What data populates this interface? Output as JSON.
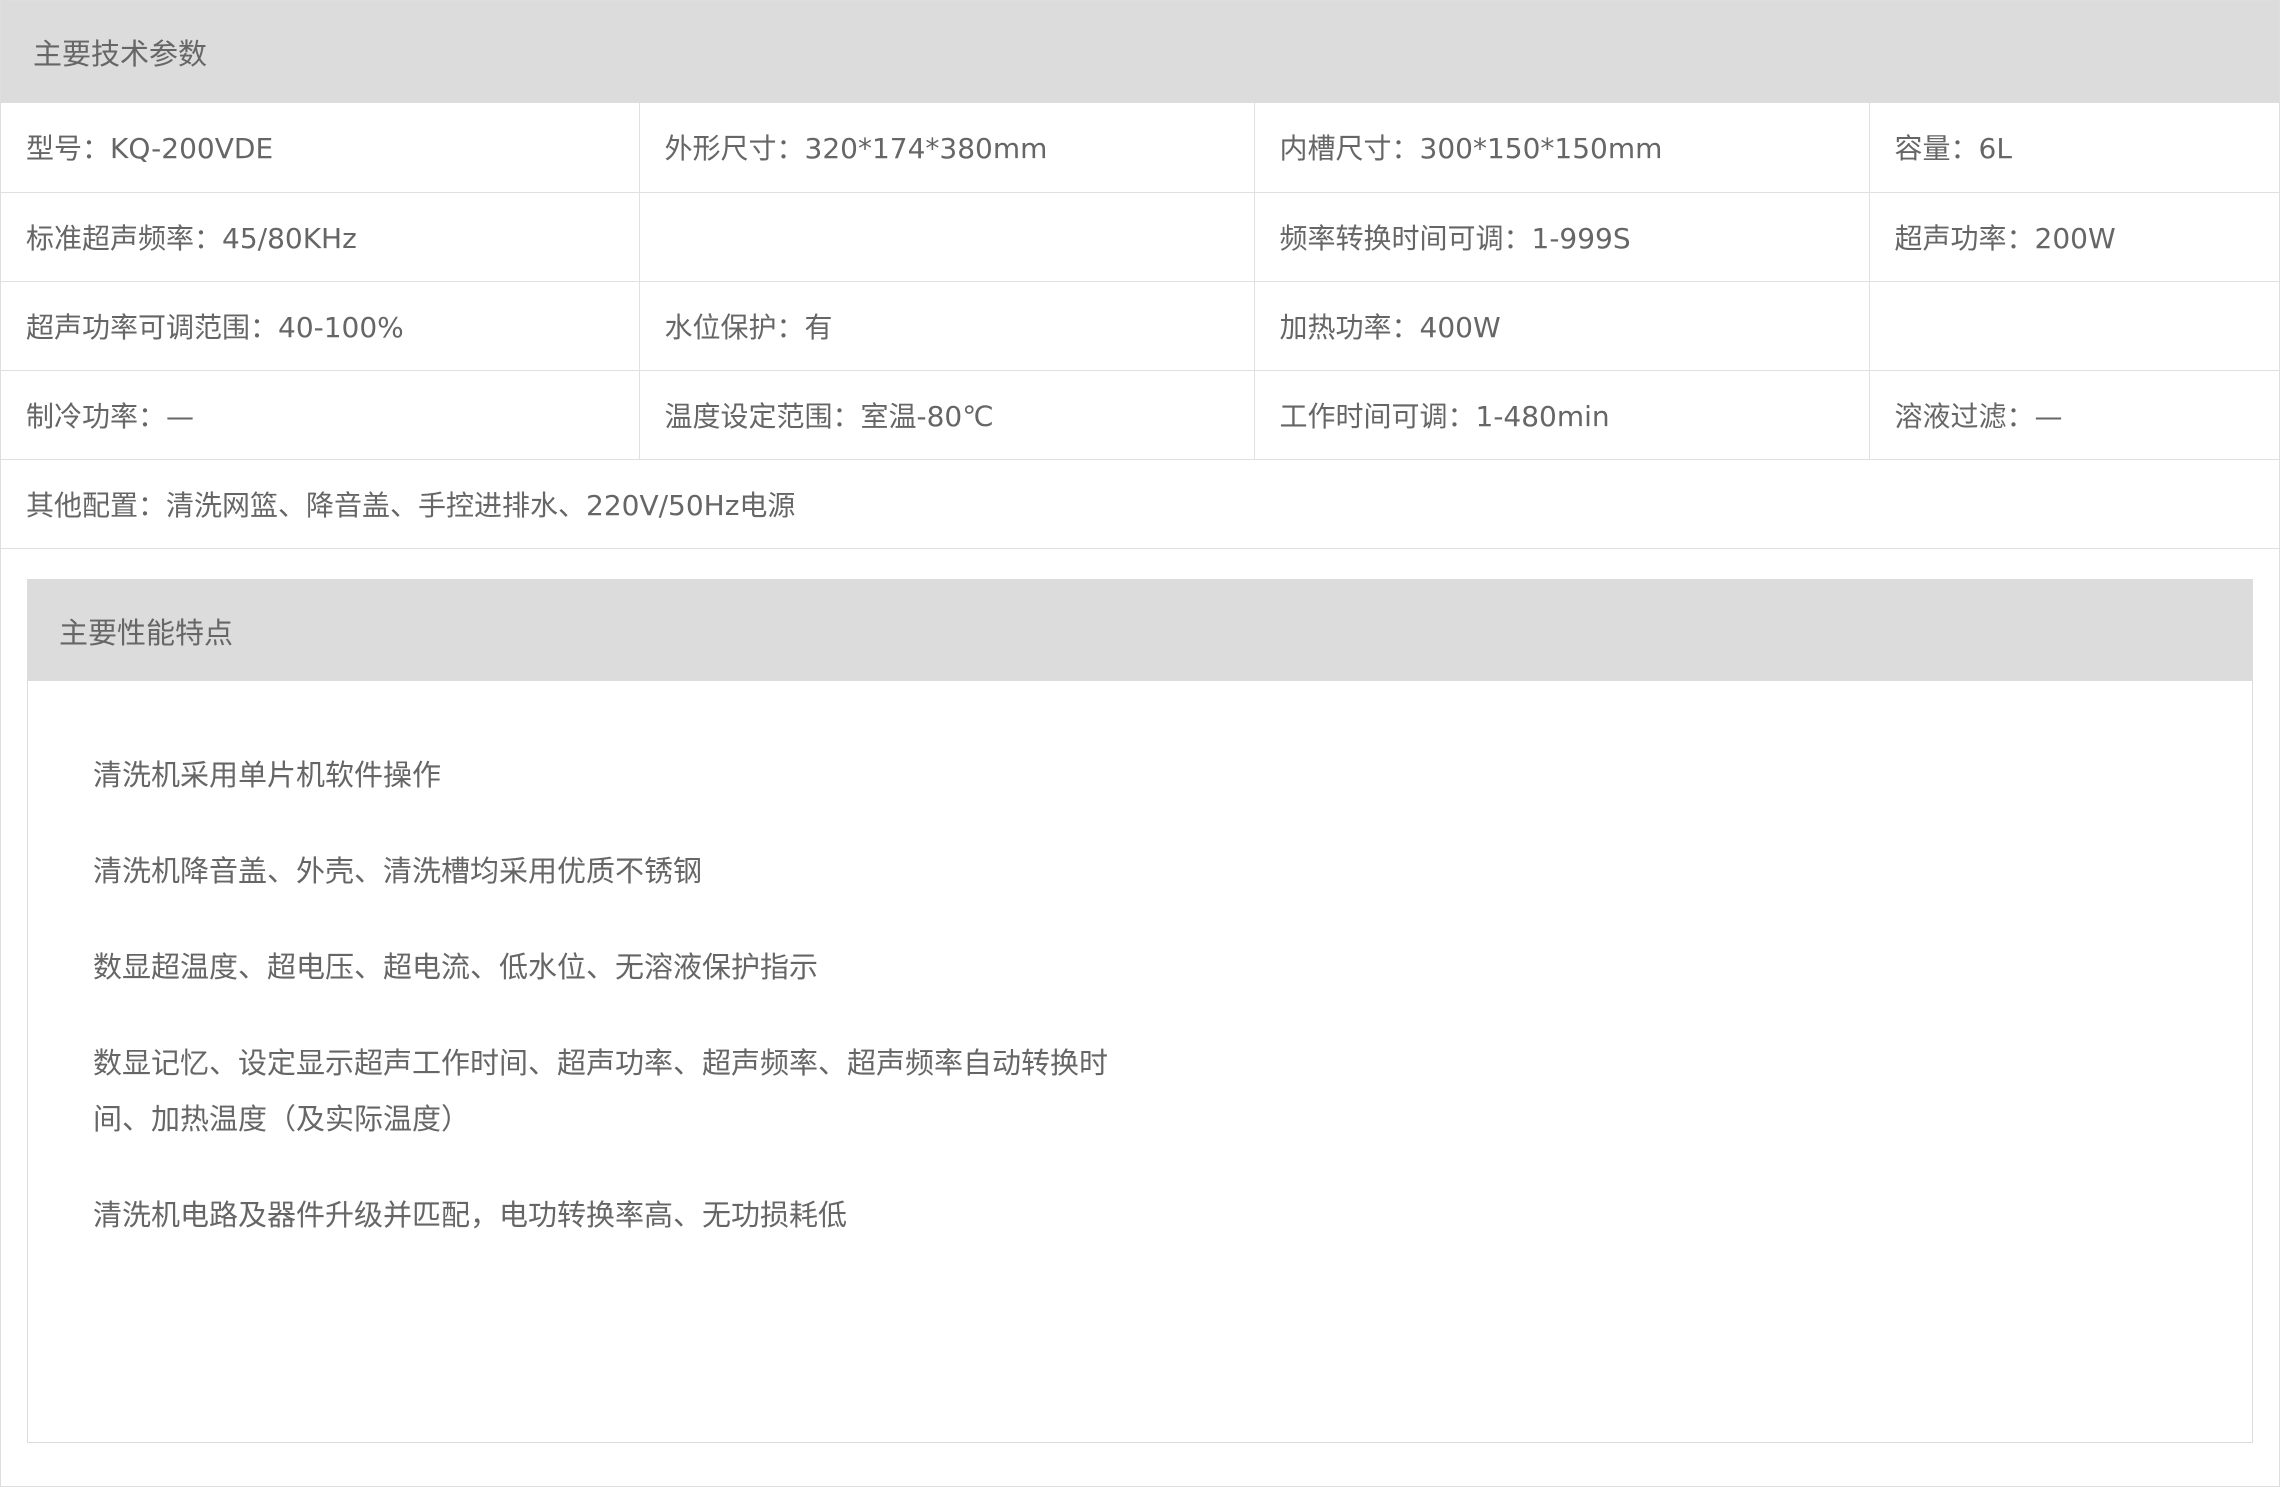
{
  "specs": {
    "title": "主要技术参数",
    "rows": [
      [
        "型号：KQ-200VDE",
        "外形尺寸：320*174*380mm",
        "内槽尺寸：300*150*150mm",
        "容量：6L"
      ],
      [
        "标准超声频率：45/80KHz",
        "",
        "频率转换时间可调：1-999S",
        "超声功率：200W"
      ],
      [
        "超声功率可调范围：40-100%",
        "水位保护：有",
        "加热功率：400W",
        ""
      ],
      [
        "制冷功率：—",
        "温度设定范围：室温-80℃",
        "工作时间可调：1-480min",
        "溶液过滤：—"
      ]
    ],
    "other": "其他配置：清洗网篮、降音盖、手控进排水、220V/50Hz电源"
  },
  "features": {
    "title": "主要性能特点",
    "items": [
      "清洗机采用单片机软件操作",
      "清洗机降音盖、外壳、清洗槽均采用优质不锈钢",
      "数显超温度、超电压、超电流、低水位、无溶液保护指示",
      "数显记忆、设定显示超声工作时间、超声功率、超声频率、超声频率自动转换时间、加热温度（及实际温度）",
      "清洗机电路及器件升级并匹配，电功转换率高、无功损耗低"
    ]
  }
}
